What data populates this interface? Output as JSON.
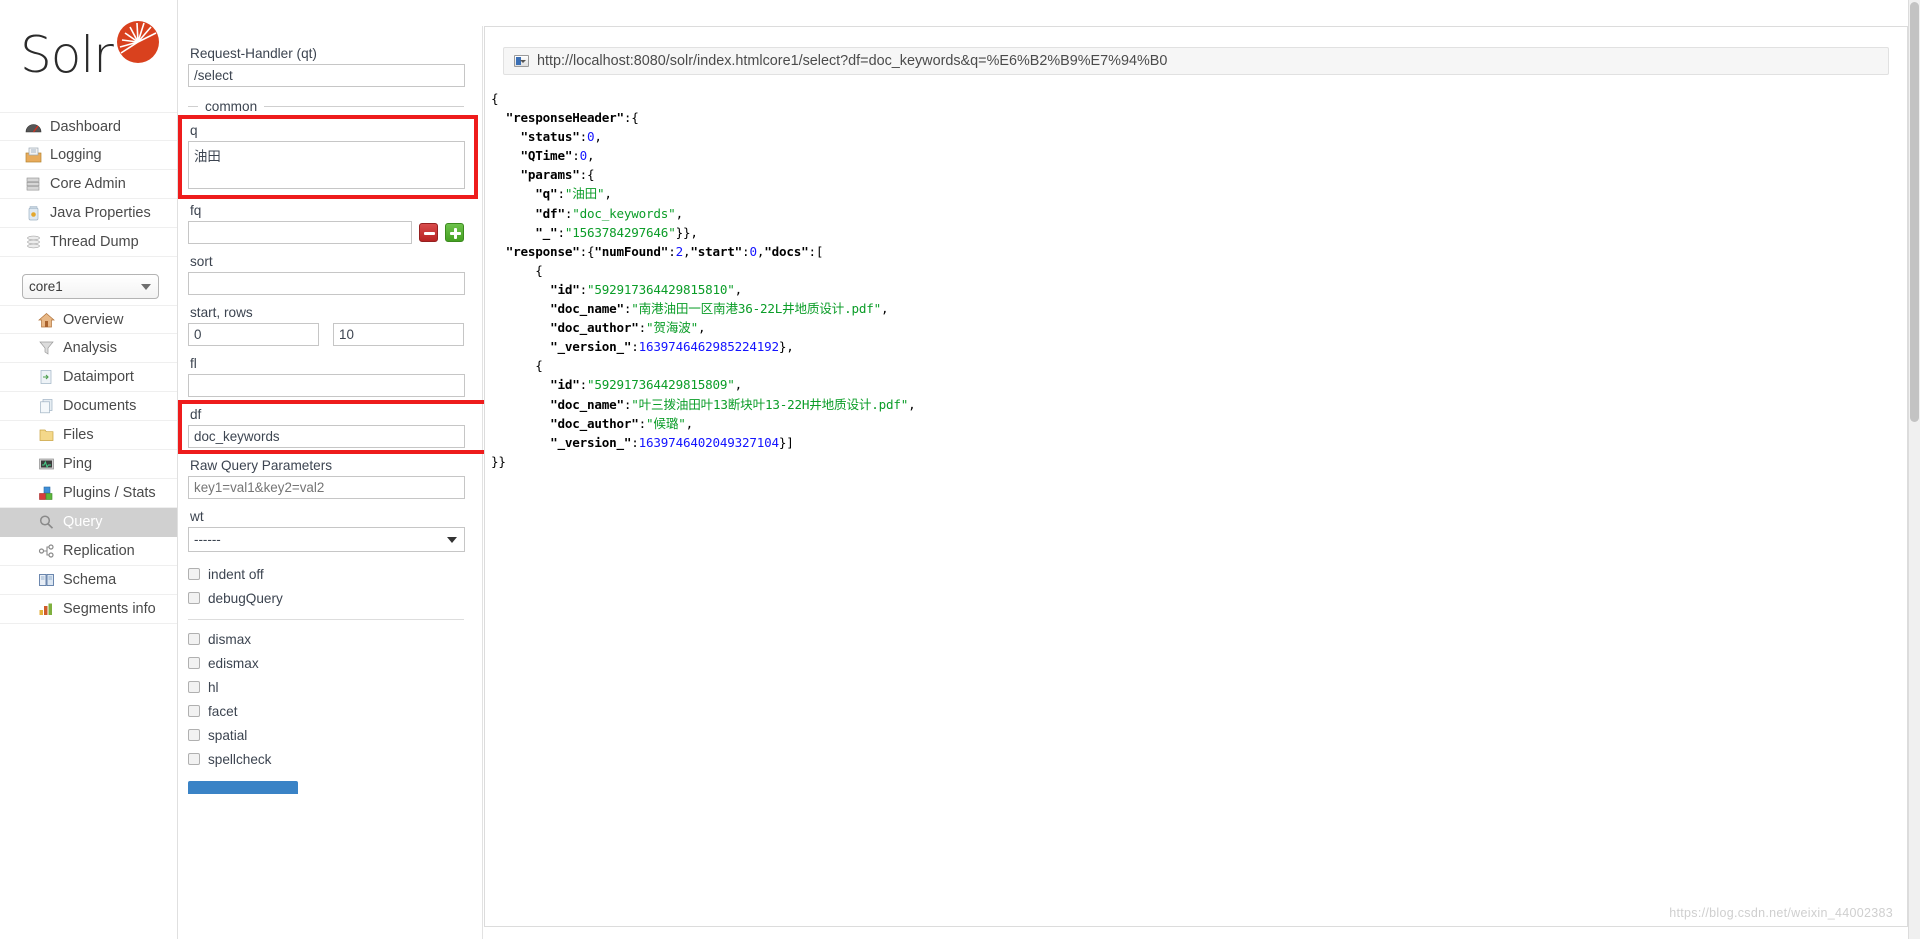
{
  "brand": {
    "name": "Solr",
    "logo_icon": "solr-sunburst-logo"
  },
  "sidebar": {
    "global_items": [
      {
        "label": "Dashboard",
        "icon": "dashboard-icon"
      },
      {
        "label": "Logging",
        "icon": "logging-icon"
      },
      {
        "label": "Core Admin",
        "icon": "core-admin-icon"
      },
      {
        "label": "Java Properties",
        "icon": "java-properties-icon"
      },
      {
        "label": "Thread Dump",
        "icon": "thread-dump-icon"
      }
    ],
    "core_selector": {
      "value": "core1",
      "caret_icon": "chevron-down-icon"
    },
    "core_items": [
      {
        "label": "Overview",
        "icon": "home-icon",
        "selected": false
      },
      {
        "label": "Analysis",
        "icon": "funnel-icon",
        "selected": false
      },
      {
        "label": "Dataimport",
        "icon": "dataimport-icon",
        "selected": false
      },
      {
        "label": "Documents",
        "icon": "documents-icon",
        "selected": false
      },
      {
        "label": "Files",
        "icon": "folder-icon",
        "selected": false
      },
      {
        "label": "Ping",
        "icon": "ping-icon",
        "selected": false
      },
      {
        "label": "Plugins / Stats",
        "icon": "plugins-icon",
        "selected": false
      },
      {
        "label": "Query",
        "icon": "magnifier-icon",
        "selected": true
      },
      {
        "label": "Replication",
        "icon": "replication-icon",
        "selected": false
      },
      {
        "label": "Schema",
        "icon": "schema-icon",
        "selected": false
      },
      {
        "label": "Segments info",
        "icon": "segments-icon",
        "selected": false
      }
    ]
  },
  "query_form": {
    "request_handler": {
      "label": "Request-Handler (qt)",
      "value": "/select"
    },
    "common_legend": "common",
    "q": {
      "label": "q",
      "value": "油田",
      "highlighted": true
    },
    "fq": {
      "label": "fq",
      "value": "",
      "remove_icon": "minus-icon",
      "add_icon": "plus-icon"
    },
    "sort": {
      "label": "sort",
      "value": ""
    },
    "start_rows": {
      "label": "start, rows",
      "start": "0",
      "rows": "10"
    },
    "fl": {
      "label": "fl",
      "value": ""
    },
    "df": {
      "label": "df",
      "value": "doc_keywords",
      "highlighted": true
    },
    "raw_query_parameters": {
      "label": "Raw Query Parameters",
      "placeholder": "key1=val1&key2=val2",
      "value": ""
    },
    "wt": {
      "label": "wt",
      "value": "------",
      "caret_icon": "chevron-down-icon"
    },
    "toggles_primary": [
      {
        "label": "indent off",
        "checked": false
      },
      {
        "label": "debugQuery",
        "checked": false
      }
    ],
    "toggles_secondary": [
      {
        "label": "dismax",
        "checked": false
      },
      {
        "label": "edismax",
        "checked": false
      },
      {
        "label": "hl",
        "checked": false
      },
      {
        "label": "facet",
        "checked": false
      },
      {
        "label": "spatial",
        "checked": false
      },
      {
        "label": "spellcheck",
        "checked": false
      }
    ],
    "highlight_color": "#ee1c1c"
  },
  "response": {
    "url": "http://localhost:8080/solr/index.htmlcore1/select?df=doc_keywords&q=%E6%B2%B9%E7%94%B0",
    "url_icon": "page-select-icon",
    "colors": {
      "key": "#000000",
      "string": "#0b9d28",
      "number": "#1414ff"
    },
    "body": {
      "responseHeader": {
        "status": 0,
        "QTime": 0,
        "params": {
          "q": "油田",
          "df": "doc_keywords",
          "_": "1563784297646"
        }
      },
      "response": {
        "numFound": 2,
        "start": 0,
        "docs": [
          {
            "id": "592917364429815810",
            "doc_name": "南港油田一区南港36-22L井地质设计.pdf",
            "doc_author": "贺海波",
            "_version_": "1639746462985224192"
          },
          {
            "id": "592917364429815809",
            "doc_name": "叶三拨油田叶13断块叶13-22H井地质设计.pdf",
            "doc_author": "候璐",
            "_version_": "1639746402049327104"
          }
        ]
      }
    }
  },
  "watermark": "https://blog.csdn.net/weixin_44002383"
}
